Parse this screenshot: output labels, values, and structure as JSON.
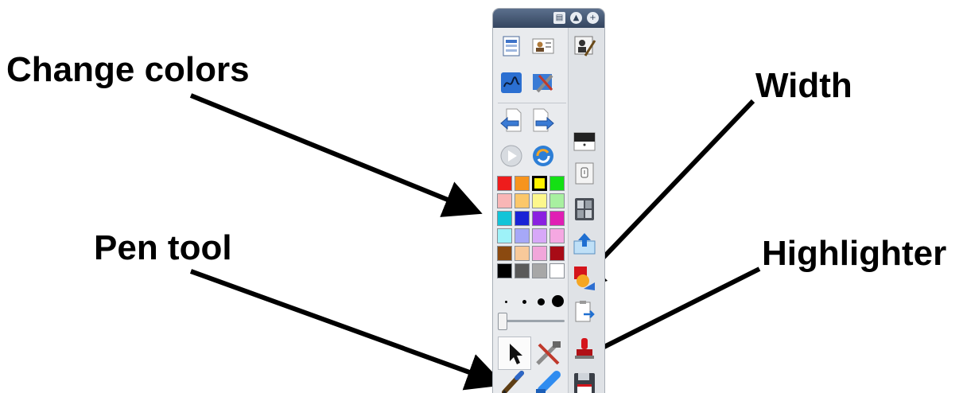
{
  "callouts": {
    "change_colors": "Change colors",
    "width": "Width",
    "pen_tool": "Pen tool",
    "highlighter": "Highlighter"
  },
  "toolbar": {
    "icons": {
      "titlebar": [
        "page-icon",
        "up-icon",
        "plus-icon"
      ],
      "main": [
        "slide-sorter-icon",
        "id-card-icon",
        "signature-icon",
        "draw-icon",
        "tools-icon",
        "back-page-icon",
        "forward-page-icon",
        "play-icon",
        "refresh-icon",
        "pointer-icon",
        "tools-icon",
        "pen-icon",
        "highlighter-icon"
      ],
      "right_column": [
        "person-pen-icon",
        "screen-shade-icon",
        "spotlight-icon",
        "calculator-icon",
        "upload-icon",
        "fill-icon",
        "clipboard-icon",
        "stamp-icon",
        "floppy-icon"
      ]
    },
    "palette": [
      "#ee1c1c",
      "#f7941d",
      "#fff200",
      "#14e014",
      "#f9b6b6",
      "#fbc76a",
      "#fdf78c",
      "#a8f0a0",
      "#12c4d8",
      "#1a23d6",
      "#8a21e0",
      "#e01fb4",
      "#9ef2f8",
      "#a6a8f8",
      "#d7a8f8",
      "#f5a8e2",
      "#8b4a10",
      "#f8c99a",
      "#f1a6da",
      "#a80b16",
      "#000000",
      "#5a5a5a",
      "#a7a7a7",
      "#ffffff"
    ],
    "selected_color": "#fff200",
    "pen_widths": [
      "tiny",
      "small",
      "medium",
      "large"
    ],
    "width_slider_fraction": 0.02
  }
}
